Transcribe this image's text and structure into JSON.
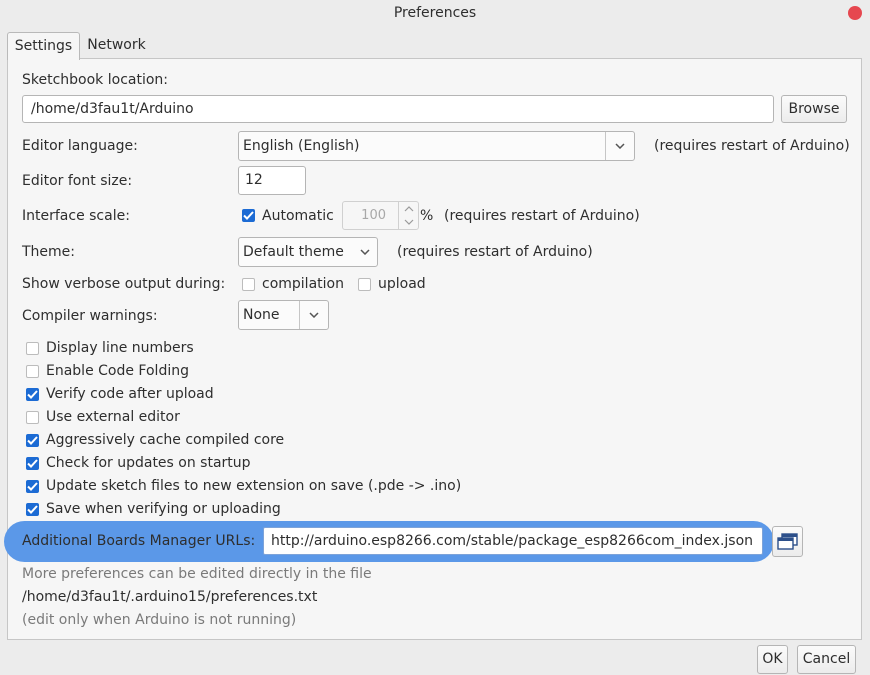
{
  "window": {
    "title": "Preferences"
  },
  "tabs": [
    {
      "label": "Settings"
    },
    {
      "label": "Network"
    }
  ],
  "sketchbook": {
    "label": "Sketchbook location:",
    "value": "/home/d3fau1t/Arduino",
    "browse_label": "Browse"
  },
  "editor_language": {
    "label": "Editor language:",
    "value": "English (English)",
    "note": "(requires restart of Arduino)"
  },
  "editor_font_size": {
    "label": "Editor font size:",
    "value": "12"
  },
  "interface_scale": {
    "label": "Interface scale:",
    "automatic_label": "Automatic",
    "automatic_checked": true,
    "value": "100",
    "unit": "%",
    "note": "(requires restart of Arduino)"
  },
  "theme": {
    "label": "Theme:",
    "value": "Default theme",
    "note": "(requires restart of Arduino)"
  },
  "verbose": {
    "label": "Show verbose output during:",
    "compilation_label": "compilation",
    "compilation_checked": false,
    "upload_label": "upload",
    "upload_checked": false
  },
  "compiler_warnings": {
    "label": "Compiler warnings:",
    "value": "None"
  },
  "options": [
    {
      "label": "Display line numbers",
      "checked": false
    },
    {
      "label": "Enable Code Folding",
      "checked": false
    },
    {
      "label": "Verify code after upload",
      "checked": true
    },
    {
      "label": "Use external editor",
      "checked": false
    },
    {
      "label": "Aggressively cache compiled core",
      "checked": true
    },
    {
      "label": "Check for updates on startup",
      "checked": true
    },
    {
      "label": "Update sketch files to new extension on save (.pde -> .ino)",
      "checked": true
    },
    {
      "label": "Save when verifying or uploading",
      "checked": true
    }
  ],
  "boards_manager": {
    "label": "Additional Boards Manager URLs:",
    "value": "http://arduino.esp8266.com/stable/package_esp8266com_index.json"
  },
  "footer_info": {
    "line1": "More preferences can be edited directly in the file",
    "line2": "/home/d3fau1t/.arduino15/preferences.txt",
    "line3": "(edit only when Arduino is not running)"
  },
  "buttons": {
    "ok": "OK",
    "cancel": "Cancel"
  },
  "colors": {
    "accent": "#1c6bd4",
    "highlight": "#5b98e8",
    "close": "#e6474f"
  }
}
